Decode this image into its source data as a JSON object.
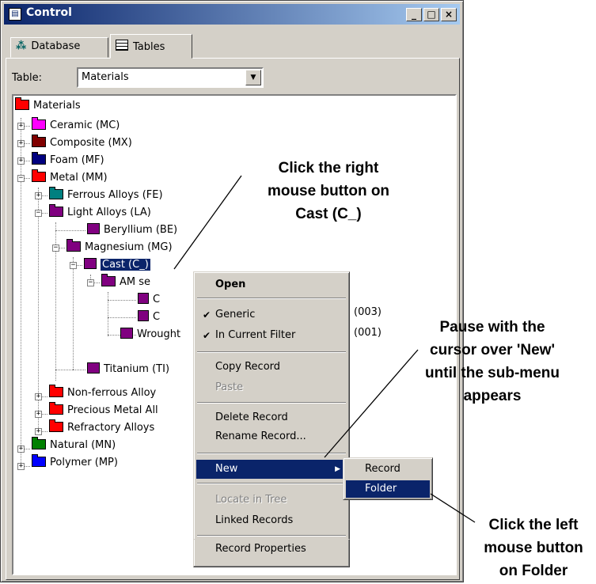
{
  "window": {
    "title": "Control",
    "icon": "control-window-icon"
  },
  "tabs": [
    {
      "label": "Database",
      "icon": "database-icon"
    },
    {
      "label": "Tables",
      "icon": "table-icon"
    }
  ],
  "table_selector": {
    "label": "Table:",
    "value": "Materials"
  },
  "tree": {
    "root": "Materials",
    "nodes": {
      "ceramic": "Ceramic (MC)",
      "composite": "Composite (MX)",
      "foam": "Foam (MF)",
      "metal": "Metal (MM)",
      "ferrous": "Ferrous Alloys (FE)",
      "light": "Light Alloys (LA)",
      "beryllium": "Beryllium (BE)",
      "magnesium": "Magnesium (MG)",
      "cast": "Cast (C_)",
      "am_series": "AM se",
      "c1": "C",
      "c2": "C",
      "wrought": "Wrought",
      "titanium": "Titanium (TI)",
      "nonferrous": "Non-ferrous Alloy",
      "precious": "Precious Metal All",
      "refractory": "Refractory Alloys",
      "natural": "Natural (MN)",
      "polymer": "Polymer (MP)"
    },
    "counts": {
      "c1": "(003)",
      "c2": "(001)"
    }
  },
  "context_menu": {
    "open": "Open",
    "generic": "Generic",
    "in_current_filter": "In Current Filter",
    "copy_record": "Copy Record",
    "paste": "Paste",
    "delete_record": "Delete Record",
    "rename_record": "Rename Record...",
    "new": "New",
    "locate_in_tree": "Locate in Tree",
    "linked_records": "Linked Records",
    "record_properties": "Record Properties"
  },
  "submenu": {
    "record": "Record",
    "folder": "Folder"
  },
  "callouts": {
    "right_click": [
      "Click the right",
      "mouse button on",
      "Cast (C_)"
    ],
    "pause": [
      "Pause with the",
      "cursor over 'New'",
      "until the sub-menu",
      "appears"
    ],
    "left_click": [
      "Click the left",
      "mouse button",
      "on Folder"
    ]
  },
  "colors": {
    "materials": "#ff0000",
    "ceramic": "#ff00ff",
    "composite": "#800000",
    "foam": "#000080",
    "metal": "#ff0000",
    "ferrous": "#008080",
    "light": "#800080",
    "natural": "#008000",
    "polymer": "#0000ff",
    "selection": "#0a246a",
    "chrome": "#d4d0c8"
  }
}
